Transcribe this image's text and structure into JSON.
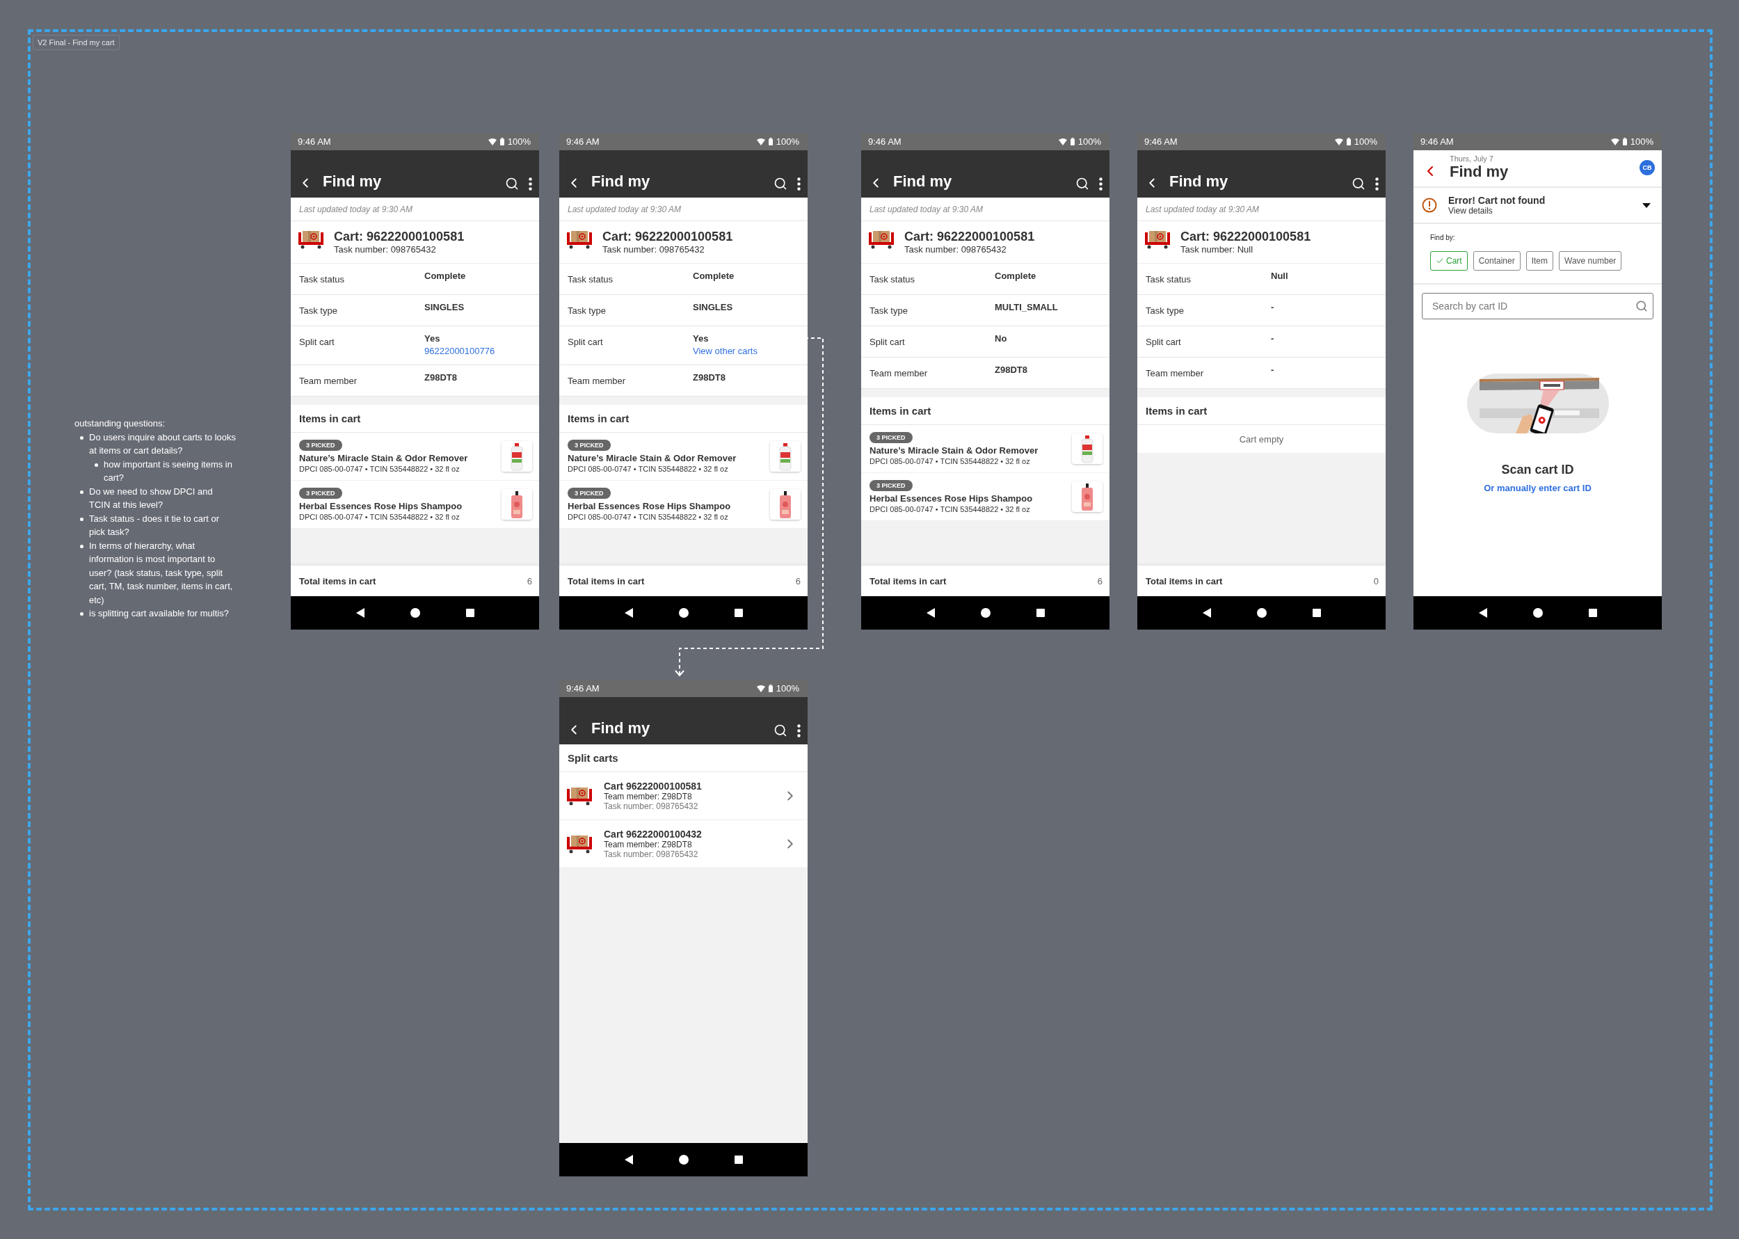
{
  "frame": {
    "label": "V2 Final - Find my cart"
  },
  "notes": {
    "heading": "outstanding questions:",
    "items": [
      {
        "text": "Do users inquire about carts to looks at items or cart details?",
        "children": [
          {
            "text": "how important is seeing items in cart?"
          }
        ]
      },
      {
        "text": "Do we need to show DPCI and TCIN at this level?"
      },
      {
        "text": "Task status - does it tie to cart or pick task?"
      },
      {
        "text": "In terms of hierarchy, what information is most important to user? (task status, task type, split cart, TM, task number, items in cart, etc)"
      },
      {
        "text": "is splitting cart available for multis?"
      }
    ]
  },
  "screens": [
    {
      "kind": "detail",
      "status_bar": {
        "time": "9:46 AM",
        "battery": "100%"
      },
      "title": "Find my",
      "last_updated": "Last updated today at 9:30 AM",
      "cart": {
        "title": "Cart: 96222000100581",
        "task_number": "Task number: 098765432"
      },
      "details": [
        {
          "label": "Task status",
          "value": "Complete"
        },
        {
          "label": "Task type",
          "value": "SINGLES"
        },
        {
          "label": "Split cart",
          "value": "Yes",
          "link": "96222000100776"
        },
        {
          "label": "Team member",
          "value": "Z98DT8"
        }
      ],
      "items_heading": "Items in cart",
      "items": [
        {
          "badge": "3 PICKED",
          "name": "Nature’s Miracle Stain & Odor Remover",
          "meta": "DPCI 085-00-0747 • TCIN 535448822 • 32 fl oz"
        },
        {
          "badge": "3 PICKED",
          "name": "Herbal Essences Rose Hips Shampoo",
          "meta": "DPCI 085-00-0747 • TCIN 535448822 • 32 fl oz"
        }
      ],
      "total": {
        "label": "Total items in cart",
        "value": "6"
      }
    },
    {
      "kind": "detail",
      "status_bar": {
        "time": "9:46 AM",
        "battery": "100%"
      },
      "title": "Find my",
      "last_updated": "Last updated today at 9:30 AM",
      "cart": {
        "title": "Cart: 96222000100581",
        "task_number": "Task number: 098765432"
      },
      "details": [
        {
          "label": "Task status",
          "value": "Complete"
        },
        {
          "label": "Task type",
          "value": "SINGLES"
        },
        {
          "label": "Split cart",
          "value": "Yes",
          "link": "View other carts"
        },
        {
          "label": "Team member",
          "value": "Z98DT8"
        }
      ],
      "items_heading": "Items in cart",
      "items": [
        {
          "badge": "3 PICKED",
          "name": "Nature’s Miracle Stain & Odor Remover",
          "meta": "DPCI 085-00-0747 • TCIN 535448822 • 32 fl oz"
        },
        {
          "badge": "3 PICKED",
          "name": "Herbal Essences Rose Hips Shampoo",
          "meta": "DPCI 085-00-0747 • TCIN 535448822 • 32 fl oz"
        }
      ],
      "total": {
        "label": "Total items in cart",
        "value": "6"
      }
    },
    {
      "kind": "detail",
      "status_bar": {
        "time": "9:46 AM",
        "battery": "100%"
      },
      "title": "Find my",
      "last_updated": "Last updated today at 9:30 AM",
      "cart": {
        "title": "Cart: 96222000100581",
        "task_number": "Task number: 098765432"
      },
      "details": [
        {
          "label": "Task status",
          "value": "Complete"
        },
        {
          "label": "Task type",
          "value": "MULTI_SMALL"
        },
        {
          "label": "Split cart",
          "value": "No"
        },
        {
          "label": "Team member",
          "value": "Z98DT8"
        }
      ],
      "items_heading": "Items in cart",
      "items": [
        {
          "badge": "3 PICKED",
          "name": "Nature’s Miracle Stain & Odor Remover",
          "meta": "DPCI 085-00-0747 • TCIN 535448822 • 32 fl oz"
        },
        {
          "badge": "3 PICKED",
          "name": "Herbal Essences Rose Hips Shampoo",
          "meta": "DPCI 085-00-0747 • TCIN 535448822 • 32 fl oz"
        }
      ],
      "total": {
        "label": "Total items in cart",
        "value": "6"
      }
    },
    {
      "kind": "detail",
      "status_bar": {
        "time": "9:46 AM",
        "battery": "100%"
      },
      "title": "Find my",
      "last_updated": "Last updated today at 9:30 AM",
      "cart": {
        "title": "Cart: 96222000100581",
        "task_number": "Task number: Null"
      },
      "details": [
        {
          "label": "Task status",
          "value": "Null"
        },
        {
          "label": "Task type",
          "value": "-"
        },
        {
          "label": "Split cart",
          "value": "-"
        },
        {
          "label": "Team member",
          "value": "-"
        }
      ],
      "items_heading": "Items in cart",
      "empty_text": "Cart empty",
      "total": {
        "label": "Total items in cart",
        "value": "0"
      }
    },
    {
      "kind": "search",
      "status_bar": {
        "time": "9:46 AM",
        "battery": "100%"
      },
      "date": "Thurs, July 7",
      "title": "Find my",
      "avatar": "CB",
      "error": {
        "title": "Error! Cart not found",
        "detail": "View details",
        "expanded": false
      },
      "find_by": {
        "label": "Find by:",
        "options": [
          {
            "label": "Cart",
            "selected": true
          },
          {
            "label": "Container",
            "selected": false
          },
          {
            "label": "Item",
            "selected": false
          },
          {
            "label": "Wave number",
            "selected": false
          }
        ]
      },
      "search": {
        "placeholder": "Search by cart ID"
      },
      "scan_title": "Scan cart ID",
      "manual_link": "Or manually enter cart ID"
    },
    {
      "kind": "split_list",
      "status_bar": {
        "time": "9:46 AM",
        "battery": "100%"
      },
      "title": "Find my",
      "section_title": "Split carts",
      "carts": [
        {
          "title": "Cart 96222000100581",
          "team_member": "Team member: Z98DT8",
          "task_number": "Task number: 098765432"
        },
        {
          "title": "Cart 96222000100432",
          "team_member": "Team member: Z98DT8",
          "task_number": "Task number: 098765432"
        }
      ]
    }
  ]
}
